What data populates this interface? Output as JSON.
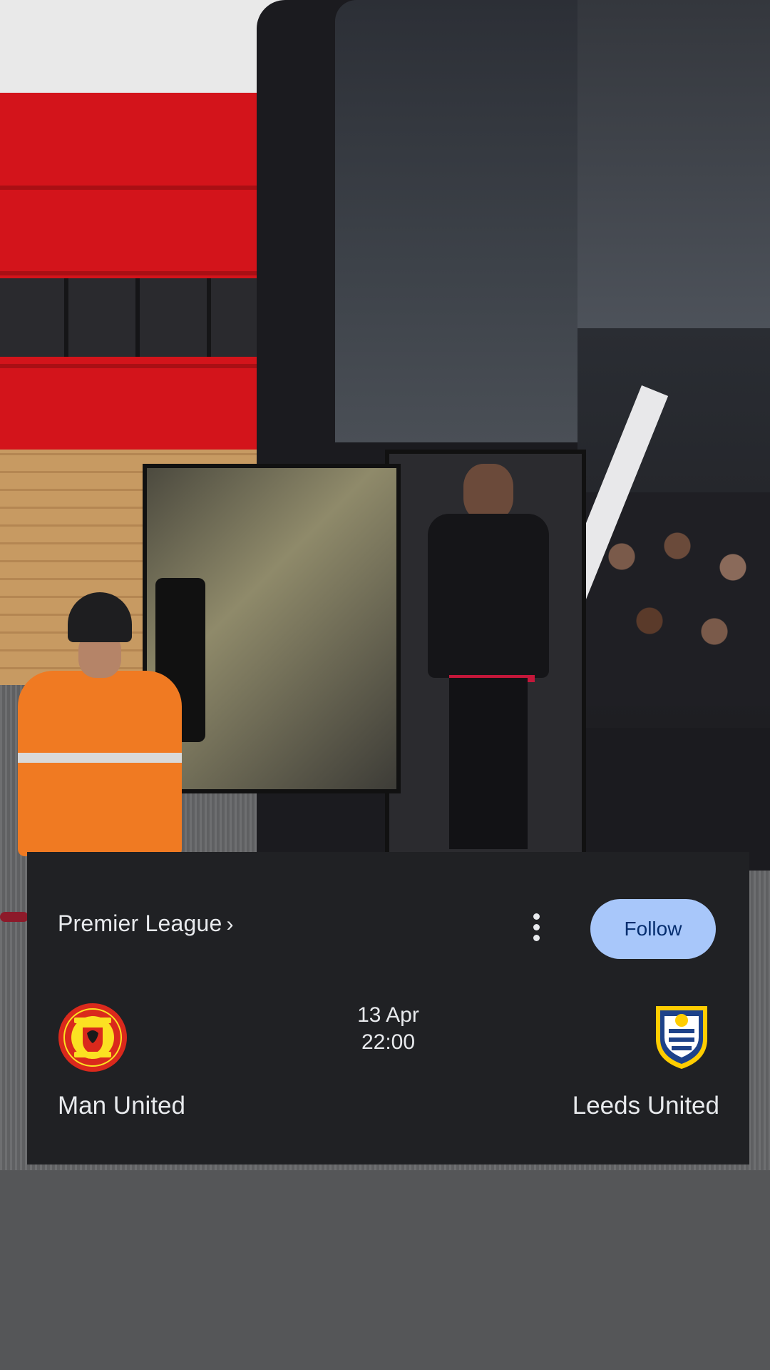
{
  "match_card": {
    "league": "Premier League",
    "league_chevron": "›",
    "follow_label": "Follow",
    "more_icon": "more-vert-icon",
    "home_team": {
      "name": "Man United",
      "crest_icon": "man-united-crest-icon",
      "crest_colors": {
        "primary": "#da291c",
        "secondary": "#fbe122"
      }
    },
    "away_team": {
      "name": "Leeds United",
      "crest_icon": "leeds-united-crest-icon",
      "crest_colors": {
        "primary": "#1d428a",
        "secondary": "#ffcd00"
      }
    },
    "date": "13 Apr",
    "time": "22:00"
  },
  "colors": {
    "card_background": "#202124",
    "follow_button": "#a8c7fa",
    "follow_text": "#062e6f",
    "text": "#e8eaed"
  }
}
